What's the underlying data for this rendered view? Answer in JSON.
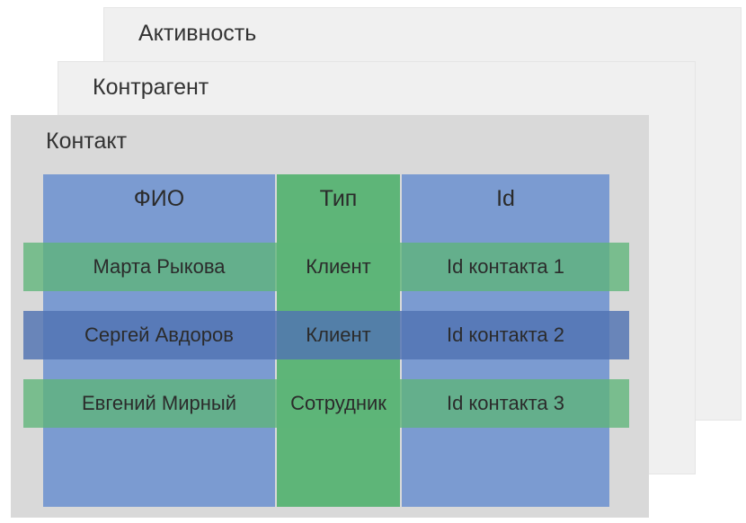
{
  "panes": {
    "activity": "Активность",
    "counterparty": "Контрагент",
    "contact": "Контакт"
  },
  "table": {
    "headers": {
      "name": "ФИО",
      "type": "Тип",
      "id": "Id"
    },
    "rows": [
      {
        "name": "Марта Рыкова",
        "type": "Клиент",
        "id": "Id контакта 1"
      },
      {
        "name": "Сергей Авдоров",
        "type": "Клиент",
        "id": "Id контакта 2"
      },
      {
        "name": "Евгений Мирный",
        "type": "Сотрудник",
        "id": "Id контакта 3"
      }
    ]
  }
}
